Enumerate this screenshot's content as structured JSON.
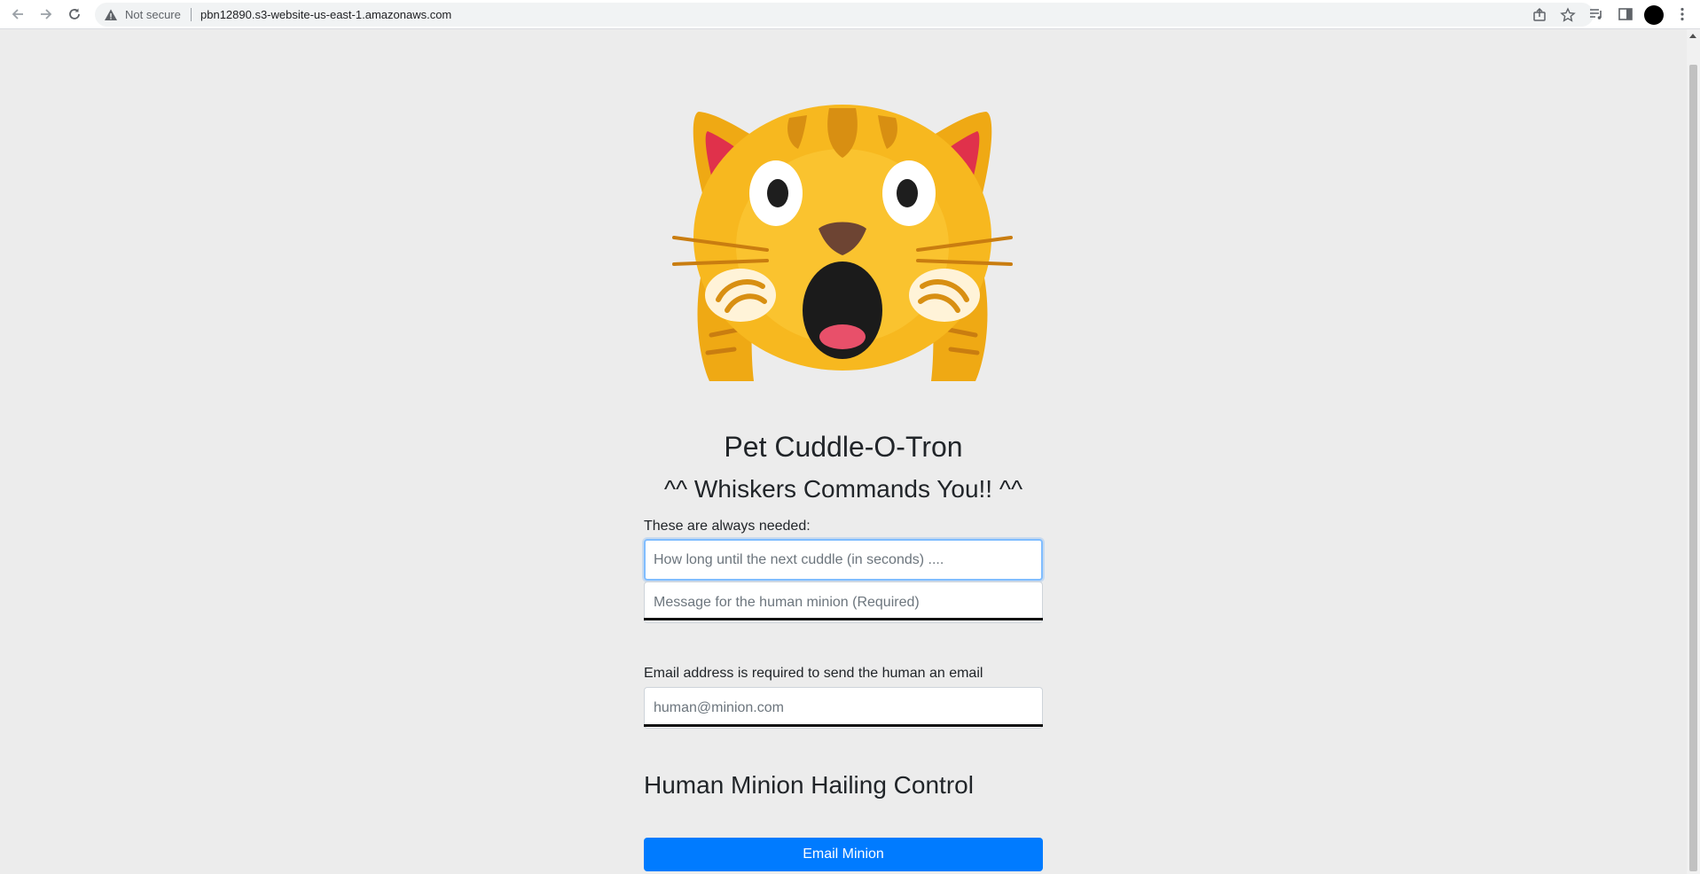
{
  "browser": {
    "security_label": "Not secure",
    "url": "pbn12890.s3-website-us-east-1.amazonaws.com",
    "icons": [
      "back-icon",
      "forward-icon",
      "reload-icon",
      "warning-icon",
      "share-icon",
      "star-icon",
      "reading-list-icon",
      "side-panel-icon",
      "profile-avatar",
      "menu-icon"
    ]
  },
  "page": {
    "image": "cat-face-emoji",
    "title": "Pet Cuddle-O-Tron",
    "subtitle": "^^ Whiskers Commands You!! ^^",
    "required_label": "These are always needed:",
    "wait_seconds": {
      "value": "",
      "placeholder": "How long until the next cuddle (in seconds) ...."
    },
    "message": {
      "value": "",
      "placeholder": "Message for the human minion (Required)"
    },
    "email_label": "Email address is required to send the human an email",
    "email": {
      "value": "",
      "placeholder": "human@minion.com"
    },
    "control_heading": "Human Minion Hailing Control",
    "email_button": "Email Minion"
  },
  "colors": {
    "page_background": "#ececec",
    "button_primary": "#007bff",
    "focus_border": "#80bdff"
  }
}
